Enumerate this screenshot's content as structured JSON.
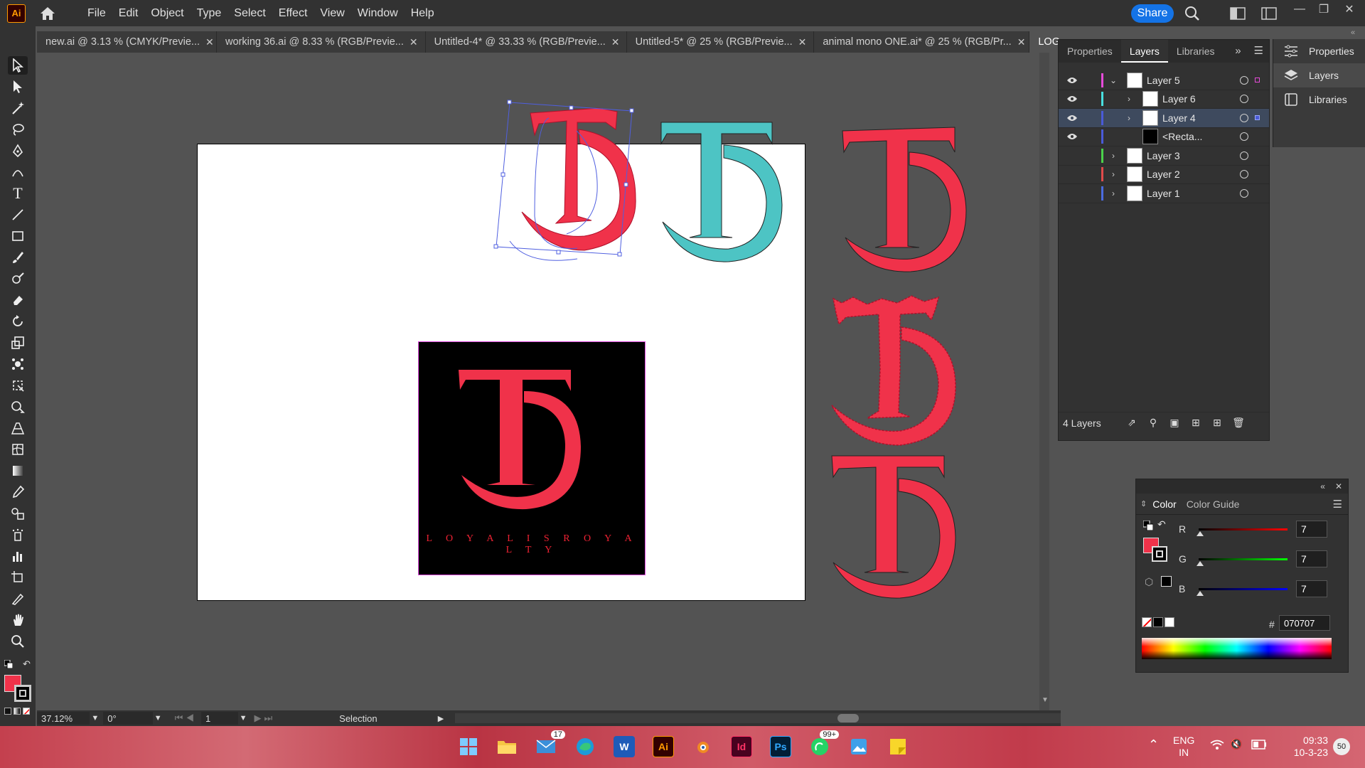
{
  "app": {
    "logo_text": "Ai"
  },
  "menu": [
    "File",
    "Edit",
    "Object",
    "Type",
    "Select",
    "Effect",
    "View",
    "Window",
    "Help"
  ],
  "share_label": "Share",
  "tabs": [
    {
      "label": "new.ai @ 3.13 % (CMYK/Previe..."
    },
    {
      "label": "working 36.ai @ 8.33 % (RGB/Previe..."
    },
    {
      "label": "Untitled-4* @ 33.33 % (RGB/Previe..."
    },
    {
      "label": "Untitled-5* @ 25 % (RGB/Previe..."
    },
    {
      "label": "animal mono ONE.ai* @ 25 % (RGB/Pr..."
    },
    {
      "label": "LOG"
    }
  ],
  "artwork": {
    "tagline": "L O Y A L   I S   R O Y A L T Y",
    "brand_red": "#f0324a",
    "teal": "#4dc4c4"
  },
  "status": {
    "zoom": "37.12%",
    "rotation": "0°",
    "artboard_index": "1",
    "tool": "Selection"
  },
  "panel_strip": [
    {
      "label": "Properties",
      "icon": "properties-icon"
    },
    {
      "label": "Layers",
      "icon": "layers-icon"
    },
    {
      "label": "Libraries",
      "icon": "libraries-icon"
    }
  ],
  "layers_panel": {
    "tabs": [
      "Properties",
      "Layers",
      "Libraries"
    ],
    "rows": [
      {
        "name": "Layer 5",
        "color": "#e64bd9",
        "visible": true,
        "expanded": true
      },
      {
        "name": "Layer 6",
        "color": "#48e0e0",
        "visible": true
      },
      {
        "name": "Layer 4",
        "color": "#4a5bd8",
        "visible": true
      },
      {
        "name": "<Recta...",
        "color": "#4a5bd8",
        "visible": true
      },
      {
        "name": "Layer 3",
        "color": "#4bd24b",
        "visible": false
      },
      {
        "name": "Layer 2",
        "color": "#e04b4b",
        "visible": false
      },
      {
        "name": "Layer 1",
        "color": "#4b6be0",
        "visible": false
      }
    ],
    "footer": "4 Layers"
  },
  "color_panel": {
    "tabs": [
      "Color",
      "Color Guide"
    ],
    "r": "7",
    "g": "7",
    "b": "7",
    "hex": "070707",
    "hex_label": "#"
  },
  "taskbar": {
    "mail_badge": "17",
    "whatsapp_badge": "99+",
    "lang1": "ENG",
    "lang2": "IN",
    "time": "09:33",
    "date": "10-3-23",
    "notif_count": "50"
  }
}
